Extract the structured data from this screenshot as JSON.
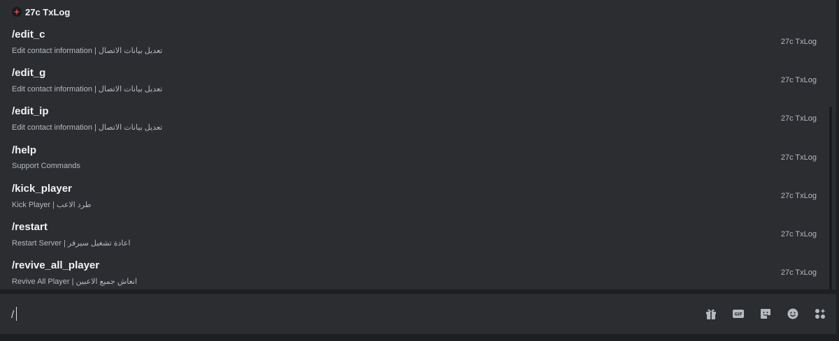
{
  "popup": {
    "app_name": "27c TxLog",
    "commands": [
      {
        "name": "/edit_c",
        "description": "Edit contact information | تعديل بيانات الاتصال",
        "app": "27c TxLog"
      },
      {
        "name": "/edit_g",
        "description": "Edit contact information | تعديل بيانات الاتصال",
        "app": "27c TxLog"
      },
      {
        "name": "/edit_ip",
        "description": "Edit contact information | تعديل بيانات الاتصال",
        "app": "27c TxLog"
      },
      {
        "name": "/help",
        "description": "Support Commands",
        "app": "27c TxLog"
      },
      {
        "name": "/kick_player",
        "description": "Kick Player | طرد الاعب",
        "app": "27c TxLog"
      },
      {
        "name": "/restart",
        "description": "Restart Server | اعادة تشغيل سيرفر",
        "app": "27c TxLog"
      },
      {
        "name": "/revive_all_player",
        "description": "Revive All Player | انعاش جميع الاعبين",
        "app": "27c TxLog"
      }
    ]
  },
  "composer": {
    "value": "/",
    "tools": [
      {
        "name": "gift-icon"
      },
      {
        "name": "gif-icon",
        "label": "GIF"
      },
      {
        "name": "sticker-icon"
      },
      {
        "name": "emoji-icon"
      },
      {
        "name": "apps-icon"
      }
    ]
  },
  "colors": {
    "background": "#1e1f22",
    "popup": "#2b2d31",
    "text_primary": "#f2f3f5",
    "text_secondary": "#b5bac1",
    "icon": "#b5bac1",
    "app_icon_accent": "#e8453c"
  }
}
